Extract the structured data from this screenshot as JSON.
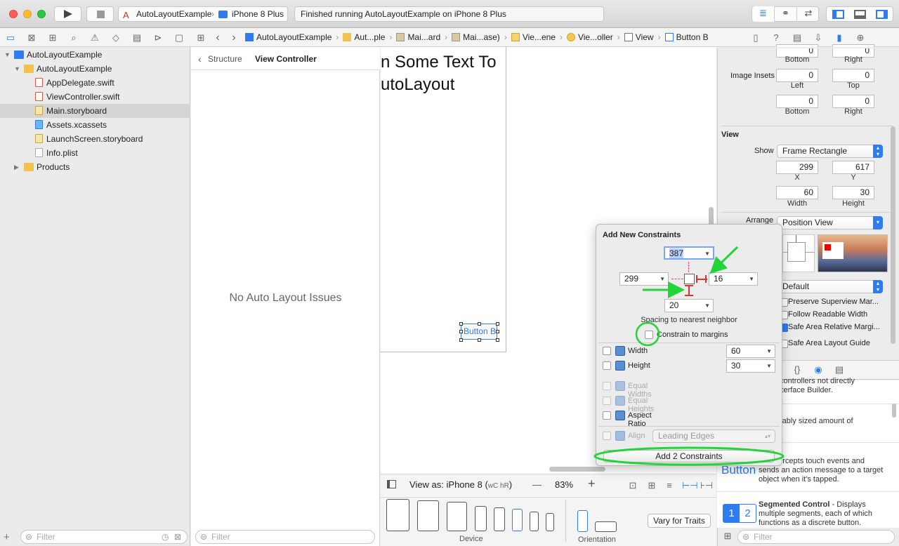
{
  "toolbar": {
    "scheme": "AutoLayoutExample",
    "device": "iPhone 8 Plus",
    "status": "Finished running AutoLayoutExample on iPhone 8 Plus"
  },
  "jumpbar": [
    {
      "label": "AutoLayoutExample",
      "icon": "project-icon"
    },
    {
      "label": "Aut...ple",
      "icon": "folder-icon"
    },
    {
      "label": "Mai...ard",
      "icon": "storyboard-icon"
    },
    {
      "label": "Mai...ase)",
      "icon": "storyboard-icon"
    },
    {
      "label": "Vie...ene",
      "icon": "scene-icon"
    },
    {
      "label": "Vie...oller",
      "icon": "view-controller-icon"
    },
    {
      "label": "View",
      "icon": "view-icon"
    },
    {
      "label": "Button B",
      "icon": "button-icon"
    }
  ],
  "navigator": {
    "items": [
      {
        "label": "AutoLayoutExample",
        "kind": "project",
        "indent": 0,
        "expanded": true
      },
      {
        "label": "AutoLayoutExample",
        "kind": "folder",
        "indent": 1,
        "expanded": true
      },
      {
        "label": "AppDelegate.swift",
        "kind": "swift",
        "indent": 2
      },
      {
        "label": "ViewController.swift",
        "kind": "swift",
        "indent": 2
      },
      {
        "label": "Main.storyboard",
        "kind": "storyboard",
        "indent": 2,
        "selected": true
      },
      {
        "label": "Assets.xcassets",
        "kind": "assets",
        "indent": 2
      },
      {
        "label": "LaunchScreen.storyboard",
        "kind": "storyboard",
        "indent": 2
      },
      {
        "label": "Info.plist",
        "kind": "plist",
        "indent": 2
      },
      {
        "label": "Products",
        "kind": "folder",
        "indent": 1,
        "expanded": false
      }
    ],
    "filter_placeholder": "Filter"
  },
  "outline": {
    "back_label": "Structure",
    "title": "View Controller",
    "empty_message": "No Auto Layout Issues",
    "filter_placeholder": "Filter"
  },
  "canvas": {
    "label_line1": "n Some Text To",
    "label_line2": "utoLayout",
    "button_label": "Button B",
    "view_as": "View as: iPhone 8 (",
    "view_as_traits": "wC hR",
    "view_as_end": ")",
    "zoom_minus": "—",
    "zoom": "83%",
    "zoom_plus": "+",
    "device_label": "Device",
    "orientation_label": "Orientation",
    "vary_button": "Vary for Traits"
  },
  "inspector": {
    "row0": {
      "bottom": "0",
      "right": "0",
      "bottom_label": "Bottom",
      "right_label": "Right"
    },
    "image_insets_label": "Image Insets",
    "row1": {
      "left": "0",
      "top": "0",
      "left_label": "Left",
      "top_label": "Top"
    },
    "row2": {
      "bottom": "0",
      "right": "0",
      "bottom_label": "Bottom",
      "right_label": "Right"
    },
    "view_section": "View",
    "show_label": "Show",
    "show_value": "Frame Rectangle",
    "x": "299",
    "y": "617",
    "x_label": "X",
    "y_label": "Y",
    "width": "60",
    "height": "30",
    "width_label": "Width",
    "height_label": "Height",
    "arrange_label": "Arrange",
    "arrange_value": "Position View",
    "layout_margins_value": "Default",
    "checks": [
      {
        "label": "Preserve Superview Mar...",
        "checked": false
      },
      {
        "label": "Follow Readable Width",
        "checked": false
      },
      {
        "label": "Safe Area Relative Margi...",
        "checked": true
      },
      {
        "label": "Safe Area Layout Guide",
        "checked": false
      }
    ],
    "library": [
      {
        "title": "",
        "desc": "s and controllers not directly"
      },
      {
        "title": "",
        "desc": "le in Interface Builder."
      },
      {
        "title": "",
        "desc": "- A variably sized amount of"
      },
      {
        "title": "",
        "desc": "ext."
      },
      {
        "title": "",
        "desc": "n - Intercepts touch events and"
      },
      {
        "title": "",
        "desc": "sends an action message to a target"
      },
      {
        "title": "",
        "desc": "object when it's tapped."
      },
      {
        "title": "Segmented Control",
        "desc": " - Displays"
      },
      {
        "title": "",
        "desc": "multiple segments, each of which"
      },
      {
        "title": "",
        "desc": "functions as a discrete button."
      }
    ],
    "button_preview": "Button",
    "seg_a": "1",
    "seg_b": "2",
    "filter_placeholder": "Filter"
  },
  "popover": {
    "title": "Add New Constraints",
    "top_value": "387",
    "leading_value": "299",
    "trailing_value": "16",
    "bottom_value": "20",
    "spacing_label": "Spacing to nearest neighbor",
    "margins_label": "Constrain to margins",
    "rows": [
      {
        "label": "Width",
        "value": "60",
        "enabled": true
      },
      {
        "label": "Height",
        "value": "30",
        "enabled": true
      },
      {
        "label": "Equal Widths",
        "enabled": false
      },
      {
        "label": "Equal Heights",
        "enabled": false
      },
      {
        "label": "Aspect Ratio",
        "enabled": true
      }
    ],
    "align_label": "Align",
    "align_value": "Leading Edges",
    "add_button": "Add 2 Constraints"
  },
  "colors": {
    "accent": "#2f7bf0",
    "annotation": "#22d43a",
    "selection": "#d5d5d5"
  }
}
